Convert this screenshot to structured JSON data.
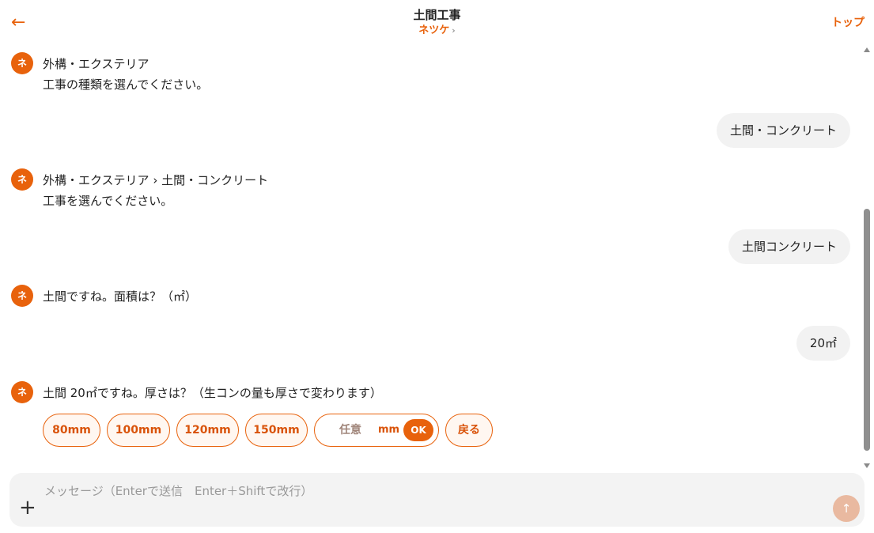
{
  "header": {
    "back_icon": "←",
    "title": "土間工事",
    "subtitle": "ネツケ",
    "subtitle_chevron": "›",
    "top_link": "トップ"
  },
  "avatar_letter": "ネ",
  "messages": [
    {
      "role": "bot",
      "lines": [
        "外構・エクステリア",
        "工事の種類を選んでください。"
      ]
    },
    {
      "role": "user",
      "text": "土間・コンクリート"
    },
    {
      "role": "bot",
      "lines": [
        "外構・エクステリア › 土間・コンクリート",
        "工事を選んでください。"
      ]
    },
    {
      "role": "user",
      "text": "土間コンクリート"
    },
    {
      "role": "bot",
      "lines": [
        "土間ですね。面積は？（㎡）"
      ]
    },
    {
      "role": "user",
      "text": "20㎡"
    },
    {
      "role": "bot",
      "lines": [
        "土間 20㎡ですね。厚さは？（生コンの量も厚さで変わります）"
      ]
    }
  ],
  "options": [
    "80mm",
    "100mm",
    "120mm",
    "150mm"
  ],
  "custom_option": {
    "placeholder": "任意",
    "unit": "mm",
    "ok_label": "OK"
  },
  "back_option": "戻る",
  "composer": {
    "placeholder": "メッセージ（Enterで送信　Enter＋Shiftで改行）",
    "plus_icon": "+",
    "send_icon": "↑"
  },
  "colors": {
    "accent": "#e8620c",
    "chip_bg": "#fff7f1",
    "user_bubble": "#f2f2f2",
    "send_disabled": "#e9b9a0"
  }
}
